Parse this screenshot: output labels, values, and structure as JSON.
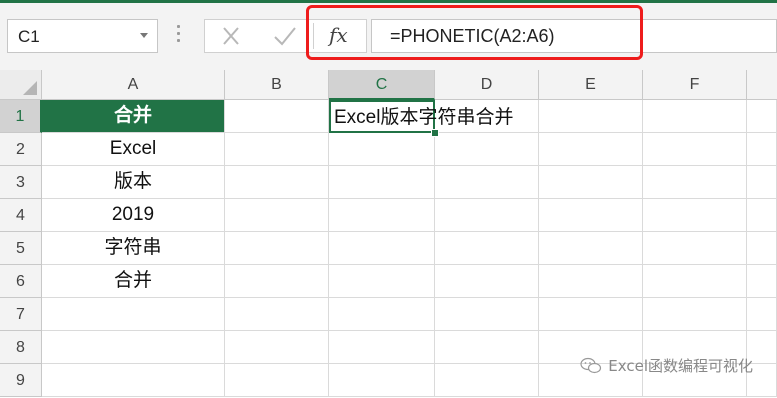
{
  "namebox": {
    "value": "C1"
  },
  "formula": {
    "text": "=PHONETIC(A2:A6)",
    "fx_label": "fx"
  },
  "columns": [
    "A",
    "B",
    "C",
    "D",
    "E",
    "F"
  ],
  "rows": [
    "1",
    "2",
    "3",
    "4",
    "5",
    "6",
    "7",
    "8",
    "9"
  ],
  "cells": {
    "A1": "合并",
    "A2": "Excel",
    "A3": "版本",
    "A4": "2019",
    "A5": "字符串",
    "A6": "合并",
    "C1": "Excel版本字符串合并"
  },
  "selected_cell": "C1",
  "watermark": "Excel函数编程可视化",
  "colors": {
    "excel_green": "#217346",
    "highlight_red": "#ee1c1c"
  }
}
